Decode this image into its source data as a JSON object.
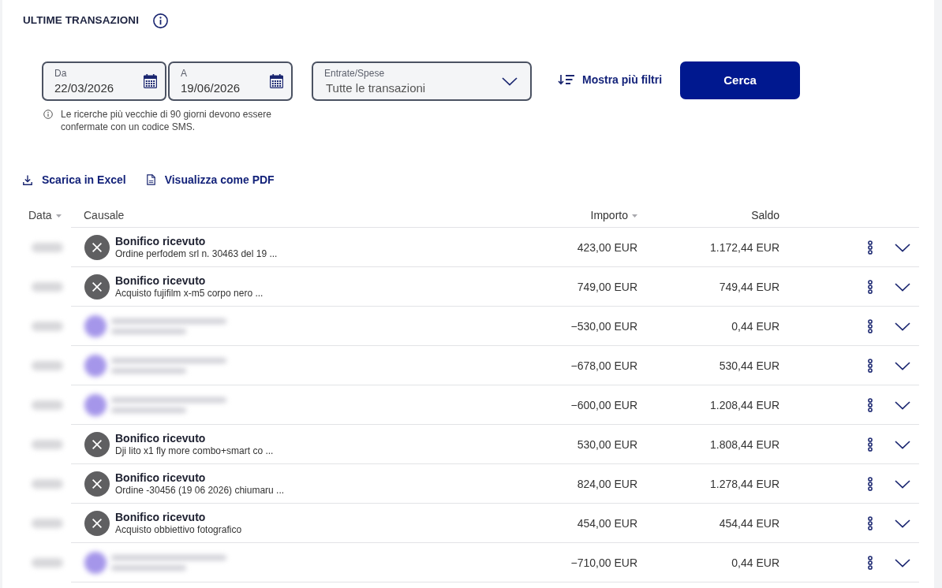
{
  "section": {
    "title": "ULTIME TRANSAZIONI"
  },
  "filters": {
    "from": {
      "label": "Da",
      "value": "22/03/2026"
    },
    "to": {
      "label": "A",
      "value": "19/06/2026"
    },
    "type_select": {
      "label": "Entrate/Spese",
      "value": "Tutte le transazioni"
    },
    "more_filters": "Mostra più filtri",
    "search_button": "Cerca",
    "note": "Le ricerche più vecchie di 90 giorni devono essere confermate con un codice SMS."
  },
  "actions": [
    {
      "kind": "download",
      "label": "Scarica in Excel"
    },
    {
      "kind": "pdf",
      "label": "Visualizza come PDF"
    }
  ],
  "table": {
    "columns": [
      {
        "label": "Data",
        "sortable": true
      },
      {
        "label": "Causale",
        "sortable": false
      },
      {
        "label": "Importo",
        "sortable": true
      },
      {
        "label": "Saldo",
        "sortable": false
      }
    ],
    "rows": [
      {
        "kind": "transfer",
        "title": "Bonifico ricevuto",
        "description": "Ordine perfodem srl n. 30463 del 19 ...",
        "amount": "423,00 EUR",
        "balance": "1.172,44 EUR"
      },
      {
        "kind": "transfer",
        "title": "Bonifico ricevuto",
        "description": "Acquisto fujifilm x-m5 corpo nero ...",
        "amount": "749,00 EUR",
        "balance": "749,44 EUR"
      },
      {
        "kind": "blurred",
        "amount": "−530,00 EUR",
        "balance": "0,44 EUR"
      },
      {
        "kind": "blurred",
        "amount": "−678,00 EUR",
        "balance": "530,44 EUR"
      },
      {
        "kind": "blurred",
        "amount": "−600,00 EUR",
        "balance": "1.208,44 EUR"
      },
      {
        "kind": "transfer",
        "title": "Bonifico ricevuto",
        "description": "Dji lito x1 fly more combo+smart co ...",
        "amount": "530,00 EUR",
        "balance": "1.808,44 EUR"
      },
      {
        "kind": "transfer",
        "title": "Bonifico ricevuto",
        "description": "Ordine -30456 (19 06 2026) chiumaru ...",
        "amount": "824,00 EUR",
        "balance": "1.278,44 EUR"
      },
      {
        "kind": "transfer",
        "title": "Bonifico ricevuto",
        "description": "Acquisto obbiettivo fotografico",
        "amount": "454,00 EUR",
        "balance": "454,44 EUR"
      },
      {
        "kind": "blurred",
        "amount": "−710,00 EUR",
        "balance": "0,44 EUR"
      }
    ]
  }
}
